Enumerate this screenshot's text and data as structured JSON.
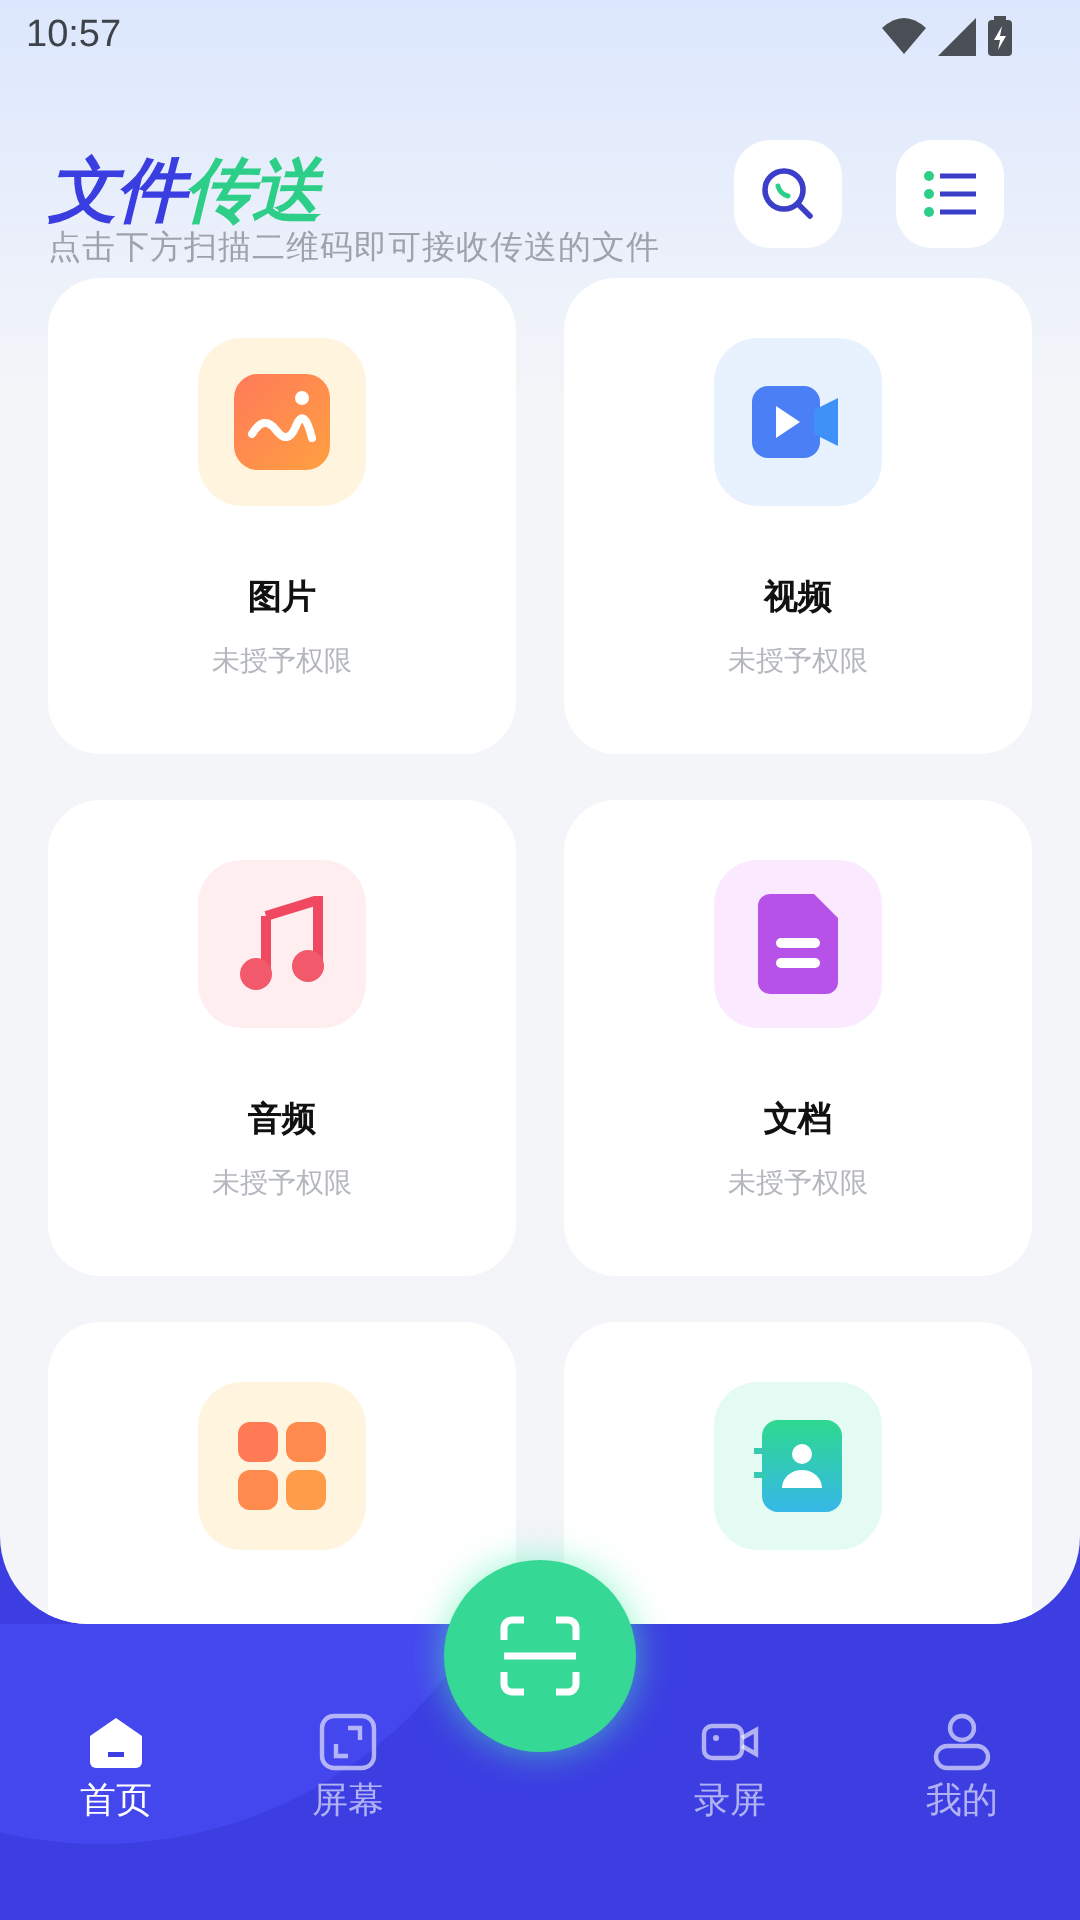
{
  "status_bar": {
    "time": "10:57"
  },
  "header": {
    "title_primary": "文件",
    "title_accent": "传送",
    "subtitle": "点击下方扫描二维码即可接收传送的文件"
  },
  "categories": [
    {
      "kind": "image",
      "name": "图片",
      "status": "未授予权限"
    },
    {
      "kind": "video",
      "name": "视频",
      "status": "未授予权限"
    },
    {
      "kind": "audio",
      "name": "音频",
      "status": "未授予权限"
    },
    {
      "kind": "document",
      "name": "文档",
      "status": "未授予权限"
    },
    {
      "kind": "apps"
    },
    {
      "kind": "contacts"
    }
  ],
  "bottom_nav": [
    {
      "kind": "home",
      "label": "首页",
      "selected": true
    },
    {
      "kind": "screen",
      "label": "屏幕",
      "selected": false
    },
    {
      "kind": "record",
      "label": "录屏",
      "selected": false
    },
    {
      "kind": "profile",
      "label": "我的",
      "selected": false
    }
  ]
}
